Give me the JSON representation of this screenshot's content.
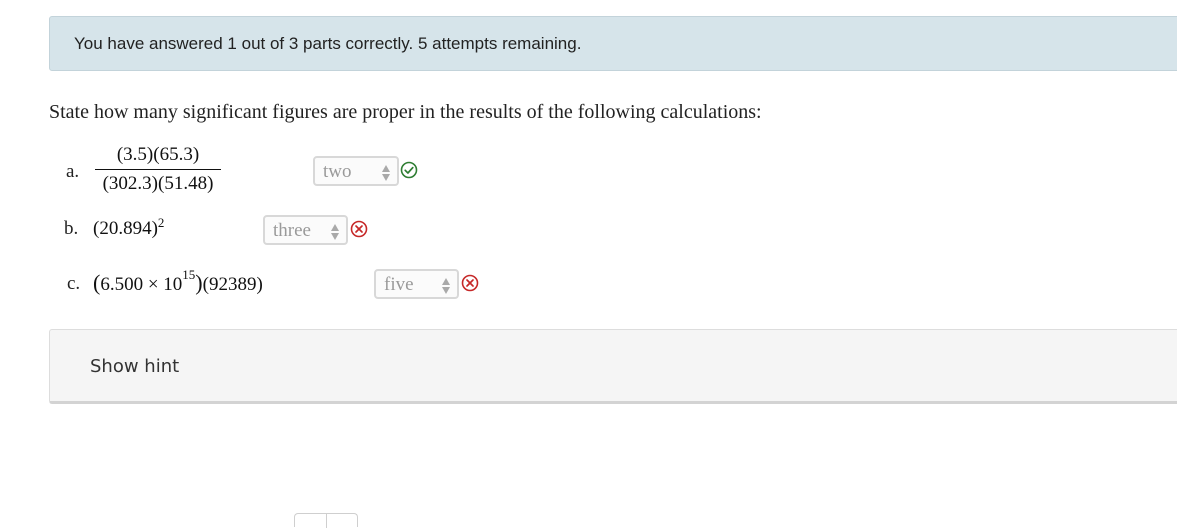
{
  "banner": {
    "message": "You have answered 1 out of 3 parts correctly. 5 attempts remaining."
  },
  "question": {
    "prompt": "State how many significant figures are proper in the results of the following calculations:"
  },
  "parts": [
    {
      "label": "a.",
      "numerator": "(3.5)(65.3)",
      "denominator": "(302.3)(51.48)",
      "selected": "two",
      "status": "correct",
      "status_icon": "check-circle-icon"
    },
    {
      "label": "b.",
      "base": "(20.894)",
      "exponent": "2",
      "selected": "three",
      "status": "incorrect",
      "status_icon": "x-circle-icon"
    },
    {
      "label": "c.",
      "open_paren": "(",
      "mantissa": "6.500",
      "times": "×",
      "power_base": "10",
      "power_exp": "15",
      "close_paren": ")",
      "second_factor": "(92389)",
      "selected": "five",
      "status": "incorrect",
      "status_icon": "x-circle-icon"
    }
  ],
  "hint": {
    "label": "Show hint"
  },
  "colors": {
    "banner_bg": "#d6e4ea",
    "correct": "#2e7d32",
    "incorrect": "#c62828",
    "hint_bg": "#f5f5f5"
  }
}
